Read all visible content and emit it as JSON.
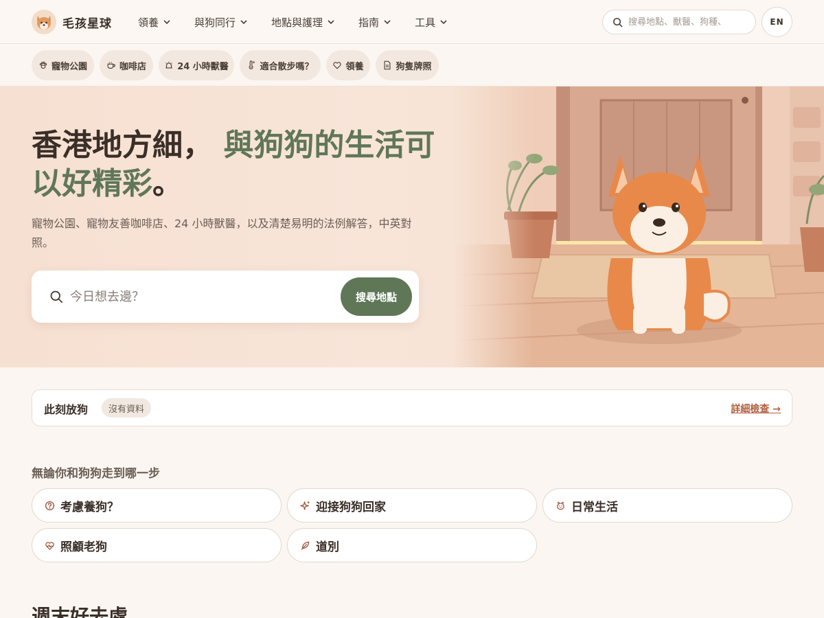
{
  "brand": {
    "name": "毛孩星球"
  },
  "nav": {
    "items": [
      {
        "label": "領養"
      },
      {
        "label": "與狗同行"
      },
      {
        "label": "地點與護理"
      },
      {
        "label": "指南"
      },
      {
        "label": "工具"
      }
    ],
    "search_placeholder": "搜尋地點、獸醫、狗種、",
    "lang_toggle": "EN"
  },
  "quick_links": [
    {
      "label": "寵物公園",
      "icon": "paw-icon"
    },
    {
      "label": "咖啡店",
      "icon": "coffee-cup-icon"
    },
    {
      "label": "24 小時獸醫",
      "icon": "siren-icon"
    },
    {
      "label": "適合散步嗎？",
      "icon": "thermometer-icon"
    },
    {
      "label": "領養",
      "icon": "heart-icon"
    },
    {
      "label": "狗隻牌照",
      "icon": "document-icon"
    }
  ],
  "hero": {
    "title_part1": "香港地方細，",
    "title_accent": "與狗狗的生活可以好精彩",
    "title_end": "。",
    "subtitle": "寵物公園、寵物友善咖啡店、24 小時獸醫，以及清楚易明的法例解答，中英對照。",
    "search_placeholder": "今日想去邊？",
    "search_button": "搜尋地點"
  },
  "walk_status": {
    "title": "此刻放狗",
    "badge": "沒有資料",
    "link": "詳細檢查 →"
  },
  "journey": {
    "heading": "無論你和狗狗走到哪一步",
    "items": [
      {
        "label": "考慮養狗？",
        "icon": "question-circle-icon"
      },
      {
        "label": "迎接狗狗回家",
        "icon": "sparkle-icon"
      },
      {
        "label": "日常生活",
        "icon": "dog-face-icon"
      },
      {
        "label": "照顧老狗",
        "icon": "heart-pulse-icon"
      },
      {
        "label": "道別",
        "icon": "feather-icon"
      }
    ]
  },
  "weekend": {
    "heading": "週末好去處"
  },
  "colors": {
    "accent_green": "#5f7757",
    "link_rust": "#b0603f",
    "background": "#fbf6f1",
    "hero_bg": "#f6e0d2"
  }
}
